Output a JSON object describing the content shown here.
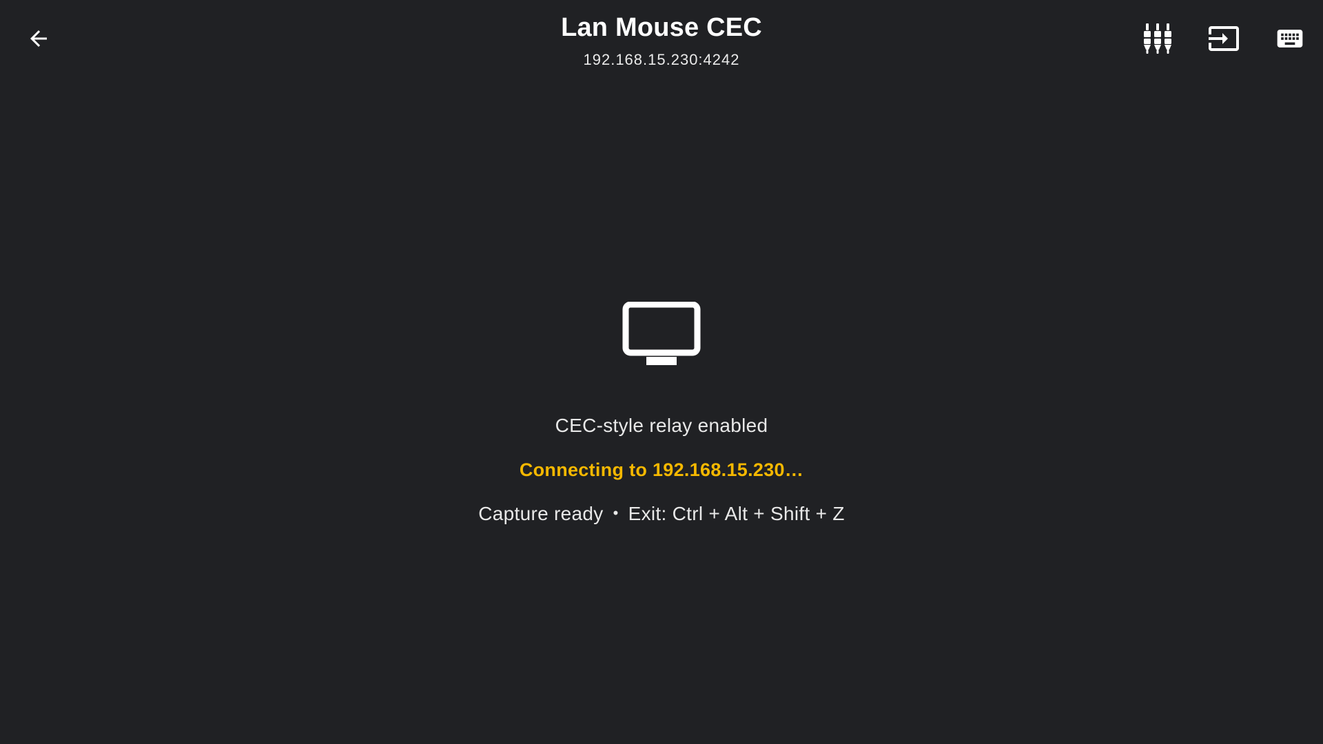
{
  "colors": {
    "background": "#202124",
    "foreground": "#ffffff",
    "accent": "#F5B800"
  },
  "header": {
    "back_icon": "arrow-left-icon",
    "title": "Lan Mouse CEC",
    "subtitle": "192.168.15.230:4242",
    "actions": [
      {
        "icon": "equalizer-icon"
      },
      {
        "icon": "input-icon"
      },
      {
        "icon": "keyboard-icon"
      }
    ]
  },
  "main": {
    "device_icon": "tv-icon",
    "relay_status": "CEC-style relay enabled",
    "connection_status": "Connecting to 192.168.15.230…",
    "capture_status": "Capture ready",
    "separator": "•",
    "exit_hint": "Exit: Ctrl + Alt + Shift + Z"
  }
}
